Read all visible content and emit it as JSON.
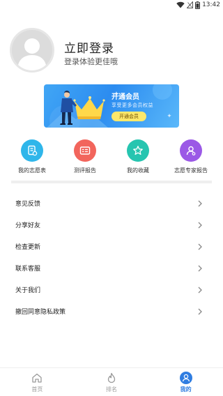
{
  "status_bar": {
    "time": "13:42"
  },
  "profile": {
    "title": "立即登录",
    "subtitle": "登录体验更佳哦"
  },
  "vip_banner": {
    "title": "开通会员",
    "subtitle": "享受更多会员权益",
    "button": "开通会员"
  },
  "quick_menu": [
    {
      "label": "我的志愿表",
      "icon": "document-icon",
      "color": "#2fb6ea"
    },
    {
      "label": "测评报告",
      "icon": "report-icon",
      "color": "#f2655c"
    },
    {
      "label": "我的收藏",
      "icon": "star-icon",
      "color": "#26c5b0"
    },
    {
      "label": "志愿专家报告",
      "icon": "expert-icon",
      "color": "#9b59e6"
    }
  ],
  "menu_list": [
    {
      "label": "意见反馈"
    },
    {
      "label": "分享好友"
    },
    {
      "label": "检查更新"
    },
    {
      "label": "联系客服"
    },
    {
      "label": "关于我们"
    },
    {
      "label": "撤回同意隐私政策"
    }
  ],
  "tab_bar": {
    "active_index": 2,
    "active_color": "#2f7de1",
    "items": [
      {
        "label": "首页",
        "icon": "home-icon"
      },
      {
        "label": "排名",
        "icon": "flame-icon"
      },
      {
        "label": "我的",
        "icon": "user-icon"
      }
    ]
  }
}
